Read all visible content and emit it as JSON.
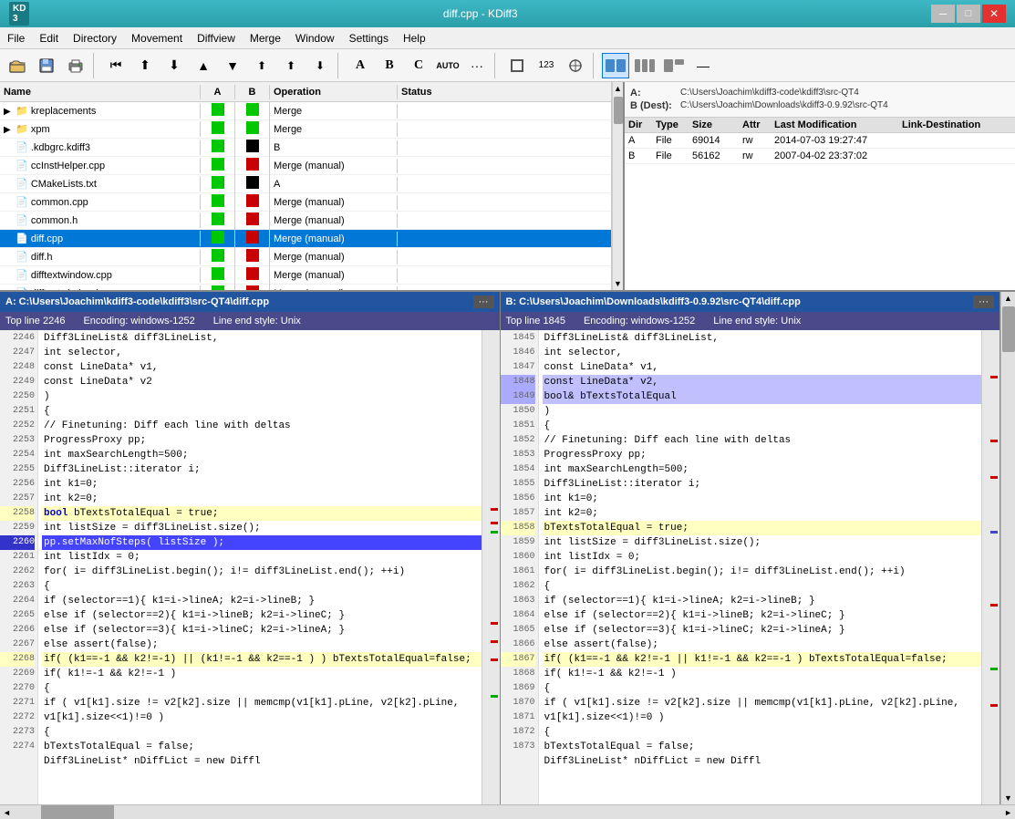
{
  "titlebar": {
    "title": "diff.cpp - KDiff3",
    "logo": "KD3",
    "min_btn": "─",
    "max_btn": "□",
    "close_btn": "✕"
  },
  "menubar": {
    "items": [
      "File",
      "Edit",
      "Directory",
      "Movement",
      "Diffview",
      "Merge",
      "Window",
      "Settings",
      "Help"
    ]
  },
  "toolbar": {
    "buttons": [
      "📁",
      "💾",
      "🖨",
      "⏮",
      "⬆",
      "⬇",
      "▲",
      "▼",
      "⬆",
      "⬆",
      "⬇",
      "A",
      "B",
      "C",
      "AUTO",
      "..."
    ]
  },
  "file_list": {
    "columns": [
      "Name",
      "A",
      "B",
      "Operation",
      "Status"
    ],
    "rows": [
      {
        "indent": 0,
        "icon": "folder",
        "expand": true,
        "name": "kreplacements",
        "a": "green",
        "b": "green",
        "op": "Merge",
        "status": ""
      },
      {
        "indent": 0,
        "icon": "folder",
        "expand": true,
        "name": "xpm",
        "a": "green",
        "b": "green",
        "op": "Merge",
        "status": ""
      },
      {
        "indent": 0,
        "icon": "file",
        "expand": false,
        "name": ".kdbgrc.kdiff3",
        "a": "green",
        "b": "black",
        "op": "B",
        "status": ""
      },
      {
        "indent": 0,
        "icon": "file",
        "expand": false,
        "name": "ccInstHelper.cpp",
        "a": "green",
        "b": "red",
        "op": "Merge (manual)",
        "status": ""
      },
      {
        "indent": 0,
        "icon": "file",
        "expand": false,
        "name": "CMakeLists.txt",
        "a": "green",
        "b": "black",
        "op": "A",
        "status": ""
      },
      {
        "indent": 0,
        "icon": "file",
        "expand": false,
        "name": "common.cpp",
        "a": "green",
        "b": "red",
        "op": "Merge (manual)",
        "status": ""
      },
      {
        "indent": 0,
        "icon": "file",
        "expand": false,
        "name": "common.h",
        "a": "green",
        "b": "red",
        "op": "Merge (manual)",
        "status": ""
      },
      {
        "indent": 0,
        "icon": "file",
        "expand": false,
        "name": "diff.cpp",
        "a": "green",
        "b": "red",
        "op": "Merge (manual)",
        "status": "",
        "selected": true
      },
      {
        "indent": 0,
        "icon": "file",
        "expand": false,
        "name": "diff.h",
        "a": "green",
        "b": "red",
        "op": "Merge (manual)",
        "status": ""
      },
      {
        "indent": 0,
        "icon": "file",
        "expand": false,
        "name": "difftextwindow.cpp",
        "a": "green",
        "b": "red",
        "op": "Merge (manual)",
        "status": ""
      },
      {
        "indent": 0,
        "icon": "file",
        "expand": false,
        "name": "difftextwindow.h",
        "a": "green",
        "b": "red",
        "op": "Merge (manual)",
        "status": ""
      }
    ]
  },
  "info_panel": {
    "path_a_label": "A:",
    "path_a_value": "C:\\Users\\Joachim\\kdiff3-code\\kdiff3\\src-QT4",
    "path_b_label": "B (Dest):",
    "path_b_value": "C:\\Users\\Joachim\\Downloads\\kdiff3-0.9.92\\src-QT4",
    "table_headers": [
      "Dir",
      "Type",
      "Size",
      "Attr",
      "Last Modification",
      "Link-Destination"
    ],
    "rows": [
      {
        "dir": "A",
        "type": "File",
        "size": "69014",
        "attr": "rw",
        "mod": "2014-07-03 19:27:47",
        "link": ""
      },
      {
        "dir": "B",
        "type": "File",
        "size": "56162",
        "attr": "rw",
        "mod": "2007-04-02 23:37:02",
        "link": ""
      }
    ]
  },
  "diff_panel_a": {
    "header": "A: C:\\Users\\Joachim\\kdiff3-code\\kdiff3\\src-QT4\\diff.cpp",
    "top_line": "Top line 2246",
    "encoding": "Encoding: windows-1252",
    "line_end": "Line end style: Unix",
    "lines": [
      {
        "num": "2246",
        "text": "    Diff3LineList& diff3LineList,",
        "style": ""
      },
      {
        "num": "2247",
        "text": "    int selector,",
        "style": ""
      },
      {
        "num": "2248",
        "text": "    const LineData* v1,",
        "style": ""
      },
      {
        "num": "2249",
        "text": "    const LineData* v2",
        "style": ""
      },
      {
        "num": "2250",
        "text": "    )",
        "style": ""
      },
      {
        "num": "2251",
        "text": "{",
        "style": ""
      },
      {
        "num": "2252",
        "text": "    // Finetuning: Diff each line with deltas",
        "style": ""
      },
      {
        "num": "2253",
        "text": "    ProgressProxy pp;",
        "style": ""
      },
      {
        "num": "2254",
        "text": "    int maxSearchLength=500;",
        "style": ""
      },
      {
        "num": "2255",
        "text": "    Diff3LineList::iterator i;",
        "style": ""
      },
      {
        "num": "2256",
        "text": "    int k1=0;",
        "style": ""
      },
      {
        "num": "2257",
        "text": "    int k2=0;",
        "style": ""
      },
      {
        "num": "2258",
        "text": "    bool bTextsTotalEqual = true;",
        "style": "highlight-yellow"
      },
      {
        "num": "2259",
        "text": "    int listSize = diff3LineList.size();",
        "style": ""
      },
      {
        "num": "2260",
        "text": "    pp.setMaxNofSteps( listSize );",
        "style": "highlight-dark-blue"
      },
      {
        "num": "2261",
        "text": "    int listIdx = 0;",
        "style": ""
      },
      {
        "num": "2262",
        "text": "    for( i= diff3LineList.begin(); i!= diff3LineList.end(); ++i)",
        "style": ""
      },
      {
        "num": "2263",
        "text": "    {",
        "style": ""
      },
      {
        "num": "2264",
        "text": "        if      (selector==1){ k1=i->lineA; k2=i->lineB; }",
        "style": ""
      },
      {
        "num": "2265",
        "text": "        else if (selector==2){ k1=i->lineB; k2=i->lineC; }",
        "style": ""
      },
      {
        "num": "2266",
        "text": "        else if (selector==3){ k1=i->lineC; k2=i->lineA; }",
        "style": ""
      },
      {
        "num": "2267",
        "text": "        else assert(false);",
        "style": ""
      },
      {
        "num": "2268",
        "text": "        if( (k1==-1 && k2!=-1)  || (k1!=-1 && k2==-1 ) ) bTextsTotalEqual=false;",
        "style": "highlight-yellow"
      },
      {
        "num": "2269",
        "text": "        if( k1!=-1 && k2!=-1 )",
        "style": ""
      },
      {
        "num": "2270",
        "text": "        {",
        "style": ""
      },
      {
        "num": "2271",
        "text": "            if ( v1[k1].size != v2[k2].size || memcmp(v1[k1].pLine, v2[k2].pLine,",
        "style": ""
      },
      {
        "num": "",
        "text": "  v1[k1].size<<1)!=0 )",
        "style": ""
      },
      {
        "num": "2272",
        "text": "            {",
        "style": ""
      },
      {
        "num": "2273",
        "text": "                bTextsTotalEqual = false;",
        "style": ""
      },
      {
        "num": "2274",
        "text": "    Diff3LineList* nDiffLict = new Diffl",
        "style": ""
      }
    ]
  },
  "diff_panel_b": {
    "header": "B: C:\\Users\\Joachim\\Downloads\\kdiff3-0.9.92\\src-QT4\\diff.cpp",
    "top_line": "Top line 1845",
    "encoding": "Encoding: windows-1252",
    "line_end": "Line end style: Unix",
    "lines": [
      {
        "num": "1845",
        "text": "    Diff3LineList& diff3LineList,",
        "style": ""
      },
      {
        "num": "1846",
        "text": "    int selector,",
        "style": ""
      },
      {
        "num": "1847",
        "text": "    const LineData* v1,",
        "style": ""
      },
      {
        "num": "1848",
        "text": "    const LineData* v2,",
        "style": "highlight-blue"
      },
      {
        "num": "1849",
        "text": "    bool& bTextsTotalEqual",
        "style": "highlight-blue"
      },
      {
        "num": "1850",
        "text": "    )",
        "style": ""
      },
      {
        "num": "1851",
        "text": "{",
        "style": ""
      },
      {
        "num": "1852",
        "text": "    // Finetuning: Diff each line with deltas",
        "style": ""
      },
      {
        "num": "1853",
        "text": "    ProgressProxy pp;",
        "style": ""
      },
      {
        "num": "1854",
        "text": "    int maxSearchLength=500;",
        "style": ""
      },
      {
        "num": "1855",
        "text": "    Diff3LineList::iterator i;",
        "style": ""
      },
      {
        "num": "1856",
        "text": "    int k1=0;",
        "style": ""
      },
      {
        "num": "1857",
        "text": "    int k2=0;",
        "style": ""
      },
      {
        "num": "1858",
        "text": "    bTextsTotalEqual = true;",
        "style": "highlight-yellow"
      },
      {
        "num": "1859",
        "text": "    int listSize = diff3LineList.size();",
        "style": ""
      },
      {
        "num": "1860",
        "text": "    int listIdx = 0;",
        "style": ""
      },
      {
        "num": "1861",
        "text": "    for( i= diff3LineList.begin(); i!= diff3LineList.end(); ++i)",
        "style": ""
      },
      {
        "num": "1862",
        "text": "    {",
        "style": ""
      },
      {
        "num": "1863",
        "text": "        if      (selector==1){ k1=i->lineA; k2=i->lineB; }",
        "style": ""
      },
      {
        "num": "1864",
        "text": "        else if (selector==2){ k1=i->lineB; k2=i->lineC; }",
        "style": ""
      },
      {
        "num": "1865",
        "text": "        else if (selector==3){ k1=i->lineC; k2=i->lineA; }",
        "style": ""
      },
      {
        "num": "1866",
        "text": "        else assert(false);",
        "style": ""
      },
      {
        "num": "1867",
        "text": "        if( (k1==-1 && k2!=-1  ||  k1!=-1 && k2==-1 ) bTextsTotalEqual=false;",
        "style": "highlight-yellow"
      },
      {
        "num": "1868",
        "text": "        if( k1!=-1 && k2!=-1 )",
        "style": ""
      },
      {
        "num": "1869",
        "text": "        {",
        "style": ""
      },
      {
        "num": "1870",
        "text": "            if ( v1[k1].size != v2[k2].size || memcmp(v1[k1].pLine, v2[k2].pLine,",
        "style": ""
      },
      {
        "num": "",
        "text": "  v1[k1].size<<1)!=0 )",
        "style": ""
      },
      {
        "num": "1871",
        "text": "            {",
        "style": ""
      },
      {
        "num": "1872",
        "text": "                bTextsTotalEqual = false;",
        "style": ""
      },
      {
        "num": "1873",
        "text": "    Diff3LineList* nDiffLict = new Diffl",
        "style": ""
      }
    ]
  }
}
